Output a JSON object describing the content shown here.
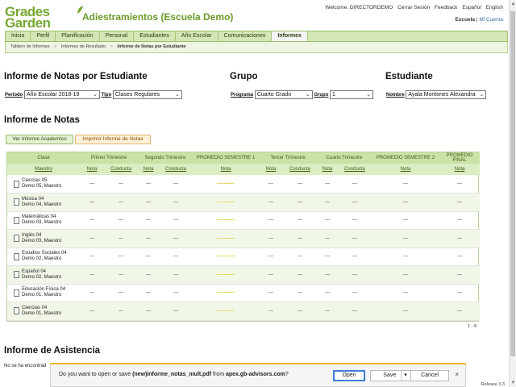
{
  "brand": {
    "logo_line1": "Grades",
    "logo_line2": "Garden",
    "school_title": "Adiestramientos (Escuela Demo)"
  },
  "header_links": [
    "Welcome: DIRECTORDEMO",
    "Cerrar Sesión",
    "Feedback",
    "Español",
    "English"
  ],
  "header_sub": {
    "role": "Escuela",
    "separator": "|",
    "account": "Mi Cuenta"
  },
  "nav": {
    "tabs": [
      "Inicio",
      "Perfil",
      "Planificación",
      "Personal",
      "Estudiantes",
      "Año Escolar",
      "Comunicaciones",
      "Informes"
    ],
    "active": "Informes"
  },
  "breadcrumb": [
    "Tablero de Informes",
    "Informes de Resultado",
    "Informe de Notas por Estudiante"
  ],
  "breadcrumb_sep": ">",
  "report": {
    "title": "Informe de Notas por Estudiante",
    "periodo_label": "Periodo",
    "periodo_value": "Año Escolar 2018-19",
    "tipo_label": "Tipo",
    "tipo_value": "Clases Regulares"
  },
  "group": {
    "title": "Grupo",
    "programa_label": "Programa",
    "programa_value": "Cuarto Grado",
    "grupo_label": "Grupo",
    "grupo_value": "1"
  },
  "student": {
    "title": "Estudiante",
    "nombre_label": "Nombre",
    "nombre_value": "Ayala Montones Alexandra"
  },
  "notas": {
    "title": "Informe de Notas",
    "btn_academic": "Ver Informe Academico",
    "btn_print": "Imprimir Informe de Notas",
    "header1": [
      "Clase",
      "Primer Trimestre",
      "Segundo Trimestre",
      "PROMEDIO SEMESTRE 1",
      "Tercer Trimestre",
      "Cuarto Trimestre",
      "PROMEDIO SEMESTRE 2",
      "PROMEDIO FINAL"
    ],
    "header2": [
      "Maestro",
      "Nota",
      "Conducta",
      "Nota",
      "Conducta",
      "Nota",
      "Nota",
      "Conducta",
      "Nota",
      "Conducta",
      "Nota",
      "Nota"
    ],
    "rows": [
      {
        "clase": "Ciencias 05",
        "maestro": "Demo 05, Maestro"
      },
      {
        "clase": "Música 04",
        "maestro": "Demo 04, Maestro"
      },
      {
        "clase": "Matemáticas 04",
        "maestro": "Demo 03, Maestro"
      },
      {
        "clase": "Inglés 04",
        "maestro": "Demo 03, Maestro"
      },
      {
        "clase": "Estudios Sociales 04",
        "maestro": "Demo 02, Maestro"
      },
      {
        "clase": "Español 04",
        "maestro": "Demo 02, Maestro"
      },
      {
        "clase": "Educación Física 04",
        "maestro": "Demo 01, Maestro"
      },
      {
        "clase": "Ciencias 04",
        "maestro": "Demo 01, Maestro"
      }
    ],
    "empty_value": "---",
    "pager": "1 - 8"
  },
  "asistencia": {
    "title": "Informe de Asistencia",
    "notice": "No se ha encontrad"
  },
  "release": "Release 3.3",
  "download_bar": {
    "prompt": "Do you want to open or save ",
    "filename": "(new)informe_notas_mult.pdf",
    "from_text": " from ",
    "host": "apex.gb-advisors.com",
    "suffix": "?",
    "open": "Open",
    "save": "Save",
    "cancel": "Cancel",
    "close": "×"
  }
}
